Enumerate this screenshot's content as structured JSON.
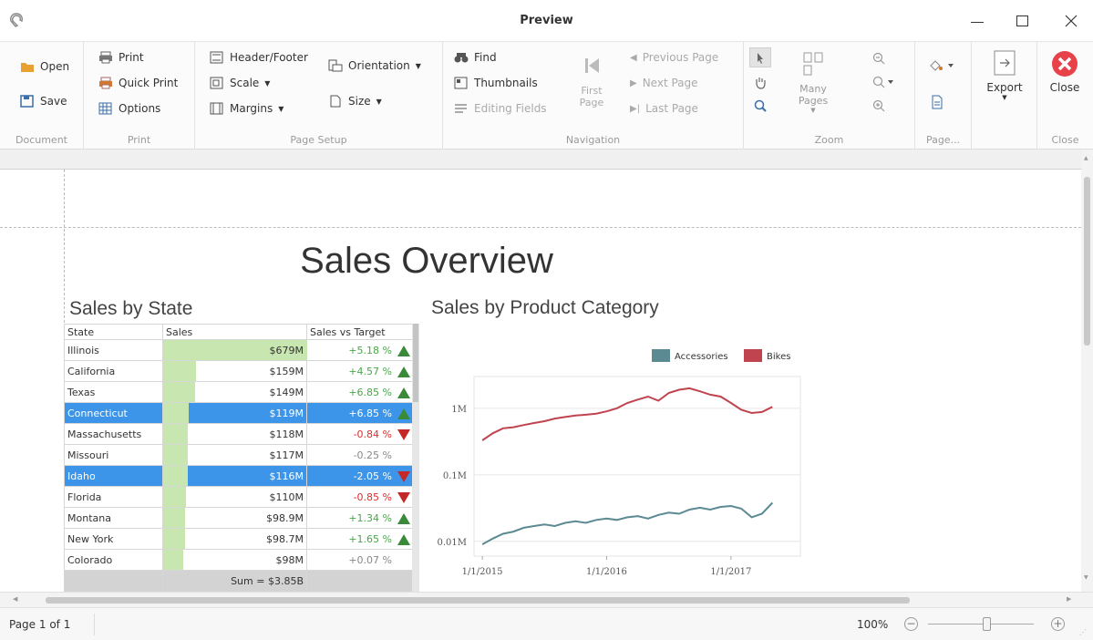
{
  "window": {
    "title": "Preview"
  },
  "ribbon": {
    "document": {
      "group": "Document",
      "open": "Open",
      "save": "Save"
    },
    "print": {
      "group": "Print",
      "print": "Print",
      "quick_print": "Quick Print",
      "options": "Options"
    },
    "page_setup": {
      "group": "Page Setup",
      "header_footer": "Header/Footer",
      "scale": "Scale",
      "margins": "Margins",
      "orientation": "Orientation",
      "size": "Size"
    },
    "navigation": {
      "group": "Navigation",
      "find": "Find",
      "thumbnails": "Thumbnails",
      "editing_fields": "Editing Fields",
      "first_page_1": "First",
      "first_page_2": "Page",
      "previous_page": "Previous Page",
      "next_page": "Next Page",
      "last_page": "Last Page"
    },
    "zoom": {
      "group": "Zoom",
      "many_pages": "Many Pages"
    },
    "page": {
      "group": "Page..."
    },
    "export": {
      "label": "Export"
    },
    "close": {
      "group": "Close",
      "label": "Close"
    }
  },
  "report": {
    "title": "Sales Overview",
    "state_heading": "Sales by State",
    "category_heading": "Sales by Product Category",
    "table": {
      "headers": [
        "State",
        "Sales",
        "Sales vs Target"
      ],
      "rows": [
        {
          "state": "Illinois",
          "sales": "$679M",
          "bar": 1.0,
          "delta": "+5.18 %",
          "trend": "up",
          "selected": false
        },
        {
          "state": "California",
          "sales": "$159M",
          "bar": 0.23,
          "delta": "+4.57 %",
          "trend": "up",
          "selected": false
        },
        {
          "state": "Texas",
          "sales": "$149M",
          "bar": 0.22,
          "delta": "+6.85 %",
          "trend": "up",
          "selected": false
        },
        {
          "state": "Connecticut",
          "sales": "$119M",
          "bar": 0.18,
          "delta": "+6.85 %",
          "trend": "up",
          "selected": true
        },
        {
          "state": "Massachusetts",
          "sales": "$118M",
          "bar": 0.17,
          "delta": "-0.84 %",
          "trend": "down",
          "selected": false
        },
        {
          "state": "Missouri",
          "sales": "$117M",
          "bar": 0.17,
          "delta": "-0.25 %",
          "trend": "none",
          "selected": false
        },
        {
          "state": "Idaho",
          "sales": "$116M",
          "bar": 0.17,
          "delta": "-2.05 %",
          "trend": "down",
          "selected": true
        },
        {
          "state": "Florida",
          "sales": "$110M",
          "bar": 0.16,
          "delta": "-0.85 %",
          "trend": "down",
          "selected": false
        },
        {
          "state": "Montana",
          "sales": "$98.9M",
          "bar": 0.15,
          "delta": "+1.34 %",
          "trend": "up",
          "selected": false
        },
        {
          "state": "New York",
          "sales": "$98.7M",
          "bar": 0.15,
          "delta": "+1.65 %",
          "trend": "up",
          "selected": false
        },
        {
          "state": "Colorado",
          "sales": "$98M",
          "bar": 0.14,
          "delta": "+0.07 %",
          "trend": "none",
          "selected": false
        }
      ],
      "sum": "Sum = $3.85B"
    }
  },
  "chart_data": {
    "type": "line",
    "title": "Sales by Product Category",
    "y_scale": "log",
    "ylim": [
      0.006,
      3
    ],
    "ytick_labels": [
      "0.01M",
      "0.1M",
      "1M"
    ],
    "ytick_values": [
      0.01,
      0.1,
      1
    ],
    "xtick_labels": [
      "1/1/2015",
      "1/1/2016",
      "1/1/2017"
    ],
    "x": [
      "2015-01",
      "2015-02",
      "2015-03",
      "2015-04",
      "2015-05",
      "2015-06",
      "2015-07",
      "2015-08",
      "2015-09",
      "2015-10",
      "2015-11",
      "2015-12",
      "2016-01",
      "2016-02",
      "2016-03",
      "2016-04",
      "2016-05",
      "2016-06",
      "2016-07",
      "2016-08",
      "2016-09",
      "2016-10",
      "2016-11",
      "2016-12",
      "2017-01",
      "2017-02",
      "2017-03",
      "2017-04",
      "2017-05"
    ],
    "legend_position": "top-right",
    "series": [
      {
        "name": "Accessories",
        "color": "#5b8a93",
        "values": [
          0.009,
          0.011,
          0.013,
          0.014,
          0.016,
          0.017,
          0.018,
          0.017,
          0.019,
          0.02,
          0.019,
          0.021,
          0.022,
          0.021,
          0.023,
          0.024,
          0.022,
          0.025,
          0.027,
          0.026,
          0.03,
          0.032,
          0.03,
          0.033,
          0.034,
          0.031,
          0.023,
          0.026,
          0.038
        ]
      },
      {
        "name": "Bikes",
        "color": "#c0444f",
        "values": [
          0.33,
          0.42,
          0.5,
          0.52,
          0.56,
          0.6,
          0.64,
          0.7,
          0.74,
          0.78,
          0.8,
          0.83,
          0.9,
          1.0,
          1.2,
          1.35,
          1.5,
          1.3,
          1.7,
          1.9,
          2.0,
          1.8,
          1.6,
          1.5,
          1.2,
          0.95,
          0.85,
          0.88,
          1.05
        ]
      }
    ]
  },
  "status": {
    "page": "Page 1 of 1",
    "zoom": "100%",
    "zoom_level": 0.55
  }
}
